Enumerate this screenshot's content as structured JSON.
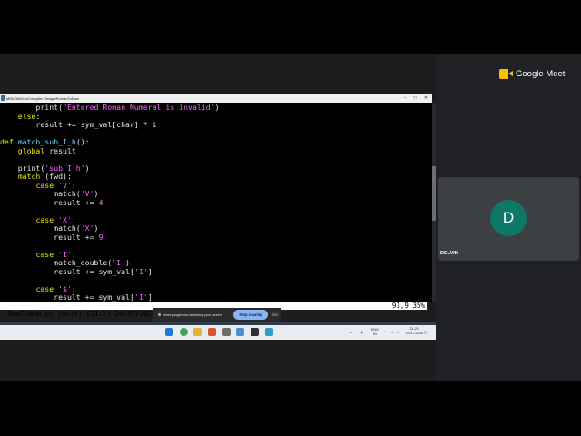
{
  "meet": {
    "logo_text": "Google Meet",
    "participant_initial": "D",
    "participant_name": "DELVIN",
    "avatar_color": "#0f7766"
  },
  "window": {
    "title": "MINGW64:/c/Compiler Design/RomanToNum"
  },
  "editor": {
    "lines": [
      [
        {
          "t": "        print(",
          "c": "txt"
        },
        {
          "t": "\"Entered Roman Numeral is invalid\"",
          "c": "str"
        },
        {
          "t": ")",
          "c": "txt"
        }
      ],
      [
        {
          "t": "    ",
          "c": "txt"
        },
        {
          "t": "else",
          "c": "kw"
        },
        {
          "t": ":",
          "c": "txt"
        }
      ],
      [
        {
          "t": "        result += sym_val[char] * i",
          "c": "txt"
        }
      ],
      [
        {
          "t": "",
          "c": "txt"
        }
      ],
      [
        {
          "t": "def ",
          "c": "kw"
        },
        {
          "t": "match_sub_I_h",
          "c": "fn"
        },
        {
          "t": "():",
          "c": "txt"
        }
      ],
      [
        {
          "t": "    ",
          "c": "txt"
        },
        {
          "t": "global",
          "c": "kw"
        },
        {
          "t": " result",
          "c": "txt"
        }
      ],
      [
        {
          "t": "",
          "c": "txt"
        }
      ],
      [
        {
          "t": "    print(",
          "c": "txt"
        },
        {
          "t": "'sub I h'",
          "c": "str"
        },
        {
          "t": ")",
          "c": "txt"
        }
      ],
      [
        {
          "t": "    ",
          "c": "txt"
        },
        {
          "t": "match",
          "c": "kw"
        },
        {
          "t": " (fwd):",
          "c": "txt"
        }
      ],
      [
        {
          "t": "        ",
          "c": "txt"
        },
        {
          "t": "case",
          "c": "kw"
        },
        {
          "t": " ",
          "c": "txt"
        },
        {
          "t": "'V'",
          "c": "str"
        },
        {
          "t": ":",
          "c": "txt"
        }
      ],
      [
        {
          "t": "            match(",
          "c": "txt"
        },
        {
          "t": "'V'",
          "c": "str"
        },
        {
          "t": ")",
          "c": "txt"
        }
      ],
      [
        {
          "t": "            result += ",
          "c": "txt"
        },
        {
          "t": "4",
          "c": "num"
        }
      ],
      [
        {
          "t": "",
          "c": "txt"
        }
      ],
      [
        {
          "t": "        ",
          "c": "txt"
        },
        {
          "t": "case",
          "c": "kw"
        },
        {
          "t": " ",
          "c": "txt"
        },
        {
          "t": "'X'",
          "c": "str"
        },
        {
          "t": ":",
          "c": "txt"
        }
      ],
      [
        {
          "t": "            match(",
          "c": "txt"
        },
        {
          "t": "'X'",
          "c": "str"
        },
        {
          "t": ")",
          "c": "txt"
        }
      ],
      [
        {
          "t": "            result += ",
          "c": "txt"
        },
        {
          "t": "9",
          "c": "num"
        }
      ],
      [
        {
          "t": "",
          "c": "txt"
        }
      ],
      [
        {
          "t": "        ",
          "c": "txt"
        },
        {
          "t": "case",
          "c": "kw"
        },
        {
          "t": " ",
          "c": "txt"
        },
        {
          "t": "'I'",
          "c": "str"
        },
        {
          "t": ":",
          "c": "txt"
        }
      ],
      [
        {
          "t": "            match_double(",
          "c": "txt"
        },
        {
          "t": "'I'",
          "c": "str"
        },
        {
          "t": ")",
          "c": "txt"
        }
      ],
      [
        {
          "t": "            result += sym_val[",
          "c": "txt"
        },
        {
          "t": "'I'",
          "c": "str"
        },
        {
          "t": "]",
          "c": "txt"
        }
      ],
      [
        {
          "t": "",
          "c": "txt"
        }
      ],
      [
        {
          "t": "        ",
          "c": "txt"
        },
        {
          "t": "case",
          "c": "kw"
        },
        {
          "t": " ",
          "c": "txt"
        },
        {
          "t": "'$'",
          "c": "str"
        },
        {
          "t": ":",
          "c": "txt"
        }
      ],
      [
        {
          "t": "            result += sym_val[",
          "c": "txt"
        },
        {
          "t": "'I'",
          "c": "str"
        },
        {
          "t": "]",
          "c": "txt"
        }
      ]
    ],
    "status_left": "RomToNum.py [unix] (21:21 24/07/2026)",
    "status_right": "91,9 35%"
  },
  "share": {
    "message": "meet.google.com is sharing your screen.",
    "stop_label": "Stop sharing",
    "hide_label": "Hide"
  },
  "taskbar": {
    "lang_line1": "ENG",
    "lang_line2": "IN",
    "time": "21:21",
    "date": "24-07-2026"
  },
  "colors": {
    "keyword": "#e6e600",
    "function": "#5fd7ff",
    "string": "#ff5fff",
    "text": "#e8e8e8"
  }
}
